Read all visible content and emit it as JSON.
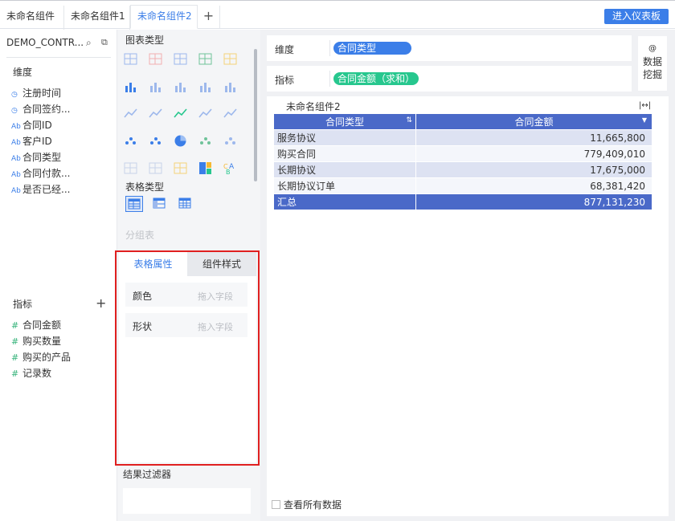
{
  "tabs": [
    {
      "label": "未命名组件"
    },
    {
      "label": "未命名组件1"
    },
    {
      "label": "未命名组件2"
    }
  ],
  "tab_add": "+",
  "enter_dashboard": "进入仪表板",
  "datasource": {
    "name": "DEMO_CONTR..."
  },
  "dimensions": {
    "label": "维度",
    "fields": [
      {
        "icon": "◷",
        "name": "注册时间"
      },
      {
        "icon": "◷",
        "name": "合同签约..."
      },
      {
        "icon": "Ab",
        "name": "合同ID"
      },
      {
        "icon": "Ab",
        "name": "客户ID"
      },
      {
        "icon": "Ab",
        "name": "合同类型"
      },
      {
        "icon": "Ab",
        "name": "合同付款..."
      },
      {
        "icon": "Ab",
        "name": "是否已经..."
      }
    ]
  },
  "measures": {
    "label": "指标",
    "fields": [
      {
        "icon": "#",
        "name": "合同金额"
      },
      {
        "icon": "#",
        "name": "购买数量"
      },
      {
        "icon": "#",
        "name": "购买的产品"
      },
      {
        "icon": "#",
        "name": "记录数"
      }
    ]
  },
  "chart_type_label": "图表类型",
  "table_type_label": "表格类型",
  "group_table_label": "分组表",
  "props": {
    "tab_table": "表格属性",
    "tab_style": "组件样式",
    "color_label": "颜色",
    "shape_label": "形状",
    "drop_placeholder": "拖入字段"
  },
  "filter_label": "结果过滤器",
  "shelf": {
    "dimension_label": "维度",
    "dimension_pill": "合同类型",
    "measure_label": "指标",
    "measure_pill": "合同金额（求和）"
  },
  "data_mining": {
    "icon": "@",
    "line1": "数据",
    "line2": "挖掘"
  },
  "component_title": "未命名组件2",
  "table": {
    "headers": [
      "合同类型",
      "合同金额"
    ],
    "rows": [
      {
        "type": "服务协议",
        "amount": "11,665,800"
      },
      {
        "type": "购买合同",
        "amount": "779,409,010"
      },
      {
        "type": "长期协议",
        "amount": "17,675,000"
      },
      {
        "type": "长期协议订单",
        "amount": "68,381,420"
      }
    ],
    "total": {
      "label": "汇总",
      "amount": "877,131,230"
    }
  },
  "view_all": "查看所有数据",
  "colors": {
    "accent": "#3b7ee8",
    "measure": "#27c78e",
    "header": "#4a69c8",
    "highlight": "#e02020"
  }
}
